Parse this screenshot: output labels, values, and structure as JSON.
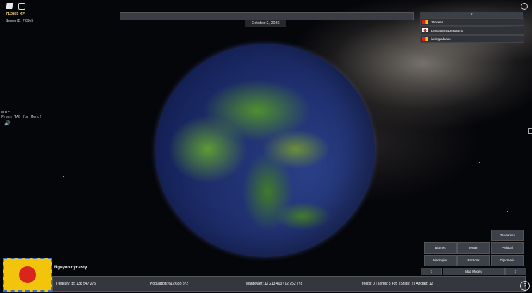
{
  "hud": {
    "xp": "712885 XP",
    "server_id": "Server ID: 7f89e5",
    "note_line1": "NOTE:",
    "note_line2": "Press TAB for Menu!"
  },
  "date": "October 2, 2036",
  "players": {
    "header": "V",
    "list": [
      {
        "name": "15ocean",
        "flag_colors": [
          "#d8261e",
          "#f2c40c"
        ]
      },
      {
        "name": "DerBaumIstDerBaums",
        "flag_colors": [
          "#ffffff",
          "#d8261e"
        ]
      },
      {
        "name": "ianingiadanae",
        "flag_colors": [
          "#d8261e",
          "#f2c40c"
        ]
      }
    ]
  },
  "map_panel": {
    "resources": "Resources",
    "biomes": "Biomes",
    "terrain": "Terrain",
    "political": "Political",
    "ideologies": "Ideologies",
    "factions": "Factions",
    "diplomatic": "Diplomatic",
    "prev": "<",
    "map_modes": "Map Modes",
    "next": ">"
  },
  "nation": {
    "name": "Nguyen dynasty",
    "flag_colors": {
      "field": "#f2c40c",
      "sun": "#d8261e",
      "border": "#3b6fd0"
    }
  },
  "stats": {
    "treasury": "Treasury:   $5 138 547 275",
    "population": "Population: 612 638 872",
    "manpower": "Manpower:   12 213 403  /  12 252 778",
    "military": "Troops: 0  |  Tanks: 5 495  |  Ships: 2  |  Aircraft: 12"
  },
  "colors": {
    "accent_xp": "#f0d060",
    "speaker": "#e02020"
  }
}
